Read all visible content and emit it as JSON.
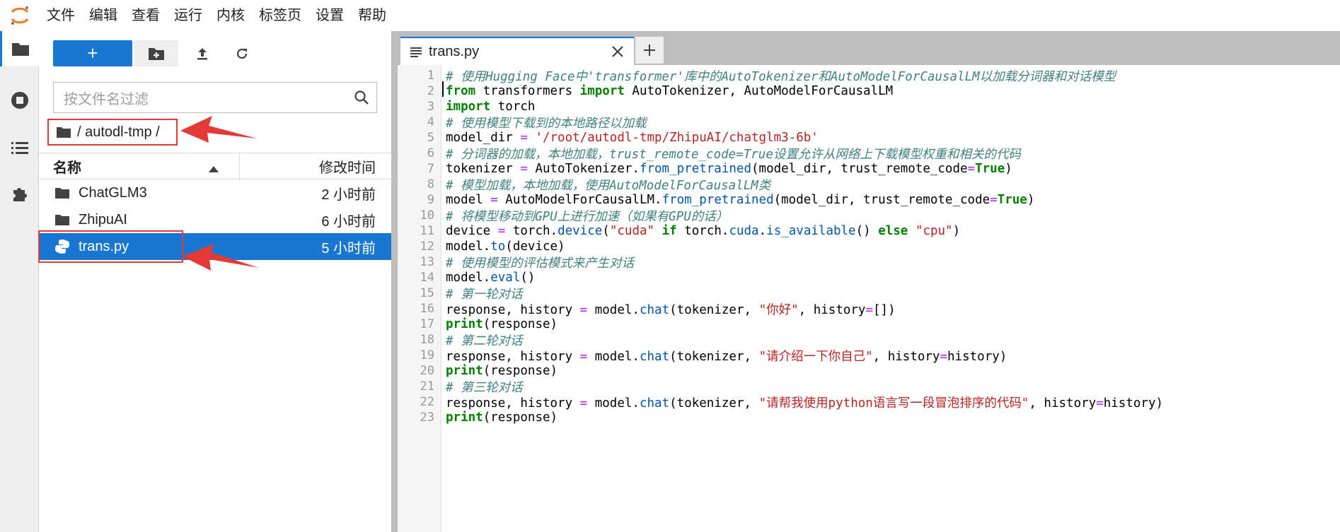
{
  "menubar": {
    "items": [
      "文件",
      "编辑",
      "查看",
      "运行",
      "内核",
      "标签页",
      "设置",
      "帮助"
    ]
  },
  "activity_icons": [
    "folder-icon",
    "running-icon",
    "toc-icon",
    "extension-icon"
  ],
  "file_browser": {
    "new_button_label": "+",
    "filter_placeholder": "按文件名过滤",
    "breadcrumb": "/ autodl-tmp /",
    "header": {
      "name": "名称",
      "modified": "修改时间"
    },
    "rows": [
      {
        "name": "ChatGLM3",
        "modified": "2 小时前",
        "type": "folder"
      },
      {
        "name": "ZhipuAI",
        "modified": "6 小时前",
        "type": "folder"
      },
      {
        "name": "trans.py",
        "modified": "5 小时前",
        "type": "python"
      }
    ]
  },
  "editor": {
    "tab_label": "trans.py",
    "lines": [
      {
        "n": "1",
        "code": "# 使用Hugging Face中'transformer'库中的AutoTokenizer和AutoModelForCausalLM以加载分词器和对话模型"
      },
      {
        "n": "2",
        "code": "from transformers import AutoTokenizer, AutoModelForCausalLM"
      },
      {
        "n": "3",
        "code": "import torch"
      },
      {
        "n": "4",
        "code": "# 使用模型下载到的本地路径以加载"
      },
      {
        "n": "5",
        "code": "model_dir = '/root/autodl-tmp/ZhipuAI/chatglm3-6b'"
      },
      {
        "n": "6",
        "code": "# 分词器的加载，本地加载，trust_remote_code=True设置允许从网络上下载模型权重和相关的代码"
      },
      {
        "n": "7",
        "code": "tokenizer = AutoTokenizer.from_pretrained(model_dir, trust_remote_code=True)"
      },
      {
        "n": "8",
        "code": "# 模型加载，本地加载，使用AutoModelForCausalLM类"
      },
      {
        "n": "9",
        "code": "model = AutoModelForCausalLM.from_pretrained(model_dir, trust_remote_code=True)"
      },
      {
        "n": "10",
        "code": "# 将模型移动到GPU上进行加速（如果有GPU的话）"
      },
      {
        "n": "11",
        "code": "device = torch.device(\"cuda\" if torch.cuda.is_available() else \"cpu\")"
      },
      {
        "n": "12",
        "code": "model.to(device)"
      },
      {
        "n": "13",
        "code": "# 使用模型的评估模式来产生对话"
      },
      {
        "n": "14",
        "code": "model.eval()"
      },
      {
        "n": "15",
        "code": "# 第一轮对话"
      },
      {
        "n": "16",
        "code": "response, history = model.chat(tokenizer, \"你好\", history=[])"
      },
      {
        "n": "17",
        "code": "print(response)"
      },
      {
        "n": "18",
        "code": "# 第二轮对话"
      },
      {
        "n": "19",
        "code": "response, history = model.chat(tokenizer, \"请介绍一下你自己\", history=history)"
      },
      {
        "n": "20",
        "code": "print(response)"
      },
      {
        "n": "21",
        "code": "# 第三轮对话"
      },
      {
        "n": "22",
        "code": "response, history = model.chat(tokenizer, \"请帮我使用python语言写一段冒泡排序的代码\", history=history)"
      },
      {
        "n": "23",
        "code": "print(response)"
      }
    ]
  },
  "colors": {
    "accent": "#1976d2",
    "highlight_box": "#e53935",
    "comment": "#408080",
    "keyword": "#008000",
    "string": "#ba2121",
    "operator": "#aa22ff",
    "method": "#0055aa"
  }
}
